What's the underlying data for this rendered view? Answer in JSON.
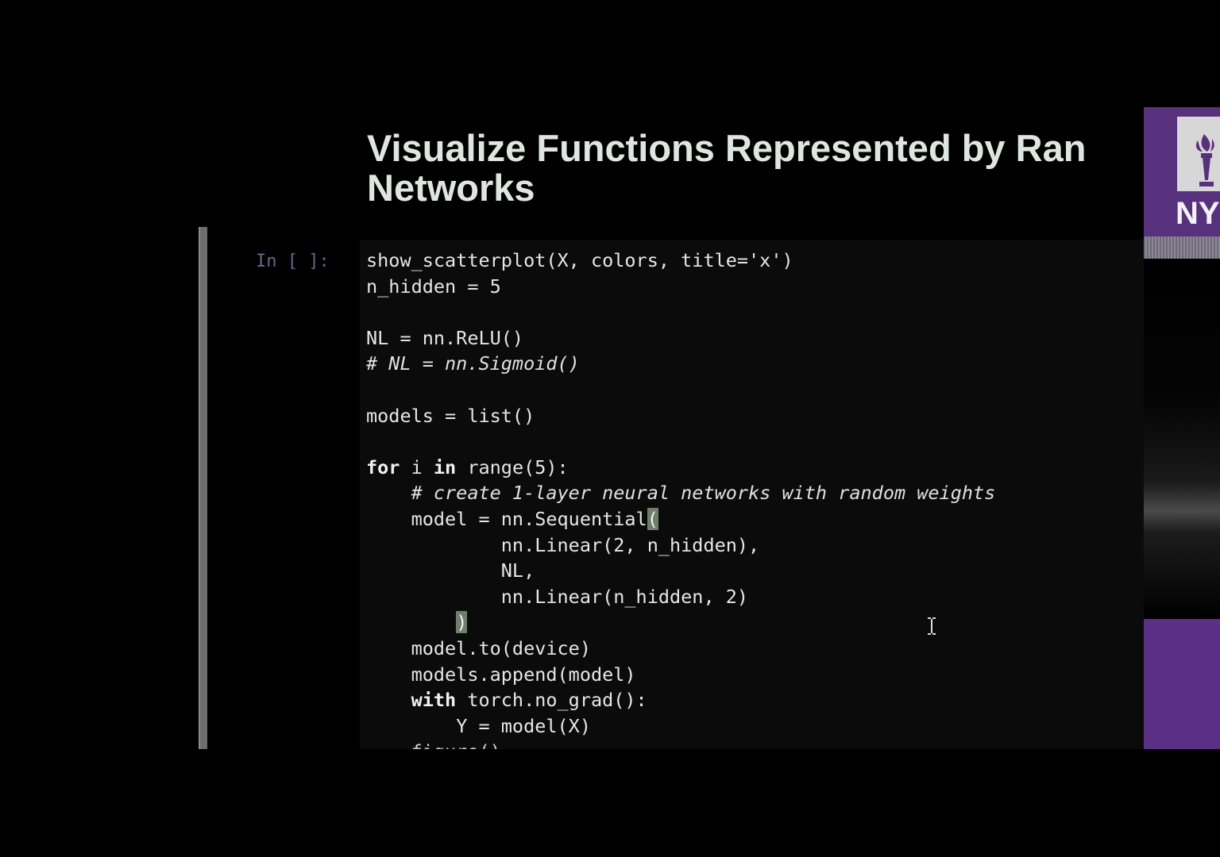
{
  "slide": {
    "title_line1": "Visualize Functions Represented by Ran",
    "title_line2": "Networks"
  },
  "cell": {
    "prompt": "In [ ]:",
    "lines": [
      "show_scatterplot(X, colors, title='x')",
      "n_hidden = 5",
      "",
      "NL = nn.ReLU()",
      "# NL = nn.Sigmoid()",
      "",
      "models = list()",
      "",
      "for i in range(5):",
      "    # create 1-layer neural networks with random weights",
      "    model = nn.Sequential(",
      "            nn.Linear(2, n_hidden),",
      "            NL,",
      "            nn.Linear(n_hidden, 2)",
      "        )",
      "    model.to(device)",
      "    models.append(model)",
      "    with torch.no_grad():",
      "        Y = model(X)",
      "    figure()"
    ],
    "code": {
      "l1": "show_scatterplot(X, colors, title='x')",
      "l2": "n_hidden = 5",
      "l4": "NL = nn.ReLU()",
      "l5": "# NL = nn.Sigmoid()",
      "l7": "models = list()",
      "l9_kw1": "for",
      "l9_a": " i ",
      "l9_kw2": "in",
      "l9_b": " range(5):",
      "l10": "# create 1-layer neural networks with random weights",
      "l11a": "model = nn.Sequential",
      "l11_paren": "(",
      "l12": "nn.Linear(2, n_hidden),",
      "l13": "NL,",
      "l14": "nn.Linear(n_hidden, 2)",
      "l15_paren": ")",
      "l16": "model.to(device)",
      "l17": "models.append(model)",
      "l18_kw": "with",
      "l18_b": " torch.no_grad():",
      "l19": "Y = model(X)",
      "l20": "figure()"
    }
  },
  "logo": {
    "text": "NY",
    "color": "#58317e"
  },
  "colors": {
    "background": "#000000",
    "title": "#dfe6e2",
    "prompt": "#6a6490",
    "bracket_highlight": "#6f7f6a",
    "brand_purple": "#58317e"
  }
}
